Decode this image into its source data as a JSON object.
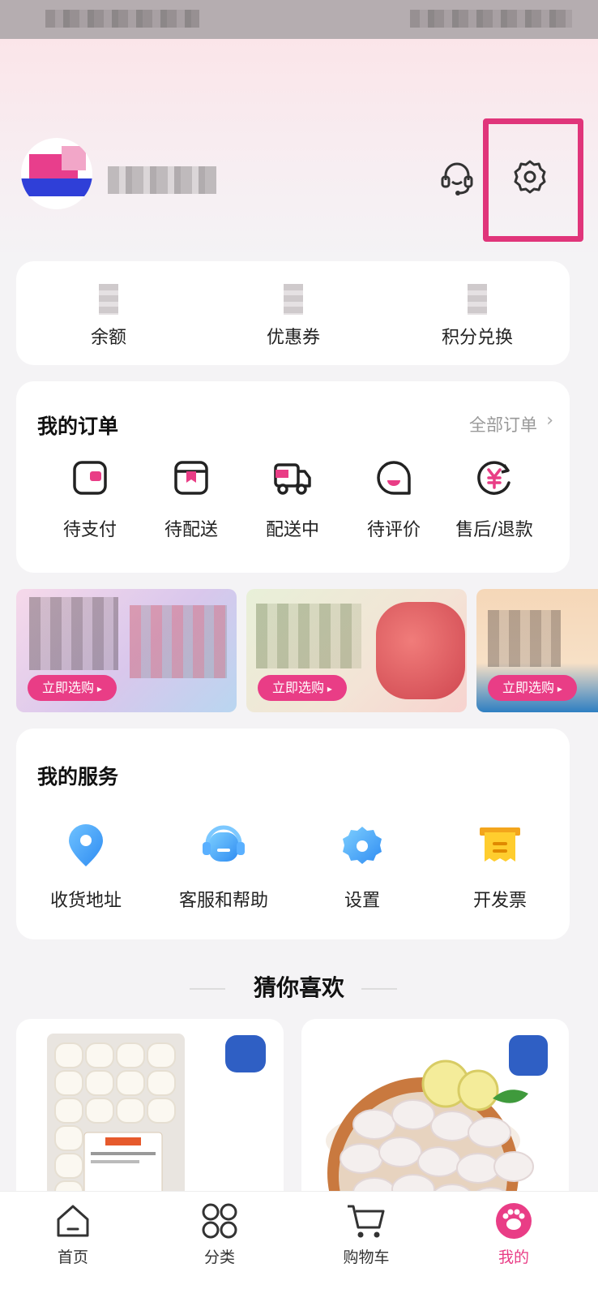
{
  "assets": {
    "items": [
      {
        "label": "余额"
      },
      {
        "label": "优惠券"
      },
      {
        "label": "积分兑换"
      }
    ]
  },
  "orders": {
    "title": "我的订单",
    "all_label": "全部订单",
    "items": [
      {
        "label": "待支付",
        "icon": "wallet-icon"
      },
      {
        "label": "待配送",
        "icon": "package-icon"
      },
      {
        "label": "配送中",
        "icon": "truck-icon"
      },
      {
        "label": "待评价",
        "icon": "smile-icon"
      },
      {
        "label": "售后/退款",
        "icon": "yuan-refund-icon"
      }
    ]
  },
  "banners": [
    {
      "cta": "立即选购"
    },
    {
      "cta": "立即选购"
    },
    {
      "cta": "立即选购"
    }
  ],
  "services": {
    "title": "我的服务",
    "items": [
      {
        "label": "收货地址",
        "icon": "location-icon"
      },
      {
        "label": "客服和帮助",
        "icon": "headset-icon"
      },
      {
        "label": "设置",
        "icon": "gear-icon"
      },
      {
        "label": "开发票",
        "icon": "invoice-icon"
      }
    ]
  },
  "recommend": {
    "title": "猜你喜欢"
  },
  "tabbar": {
    "items": [
      {
        "label": "首页"
      },
      {
        "label": "分类"
      },
      {
        "label": "购物车"
      },
      {
        "label": "我的"
      }
    ]
  },
  "colors": {
    "accent": "#e93d86",
    "highlight": "#e0357a",
    "background": "#f4f3f5"
  }
}
